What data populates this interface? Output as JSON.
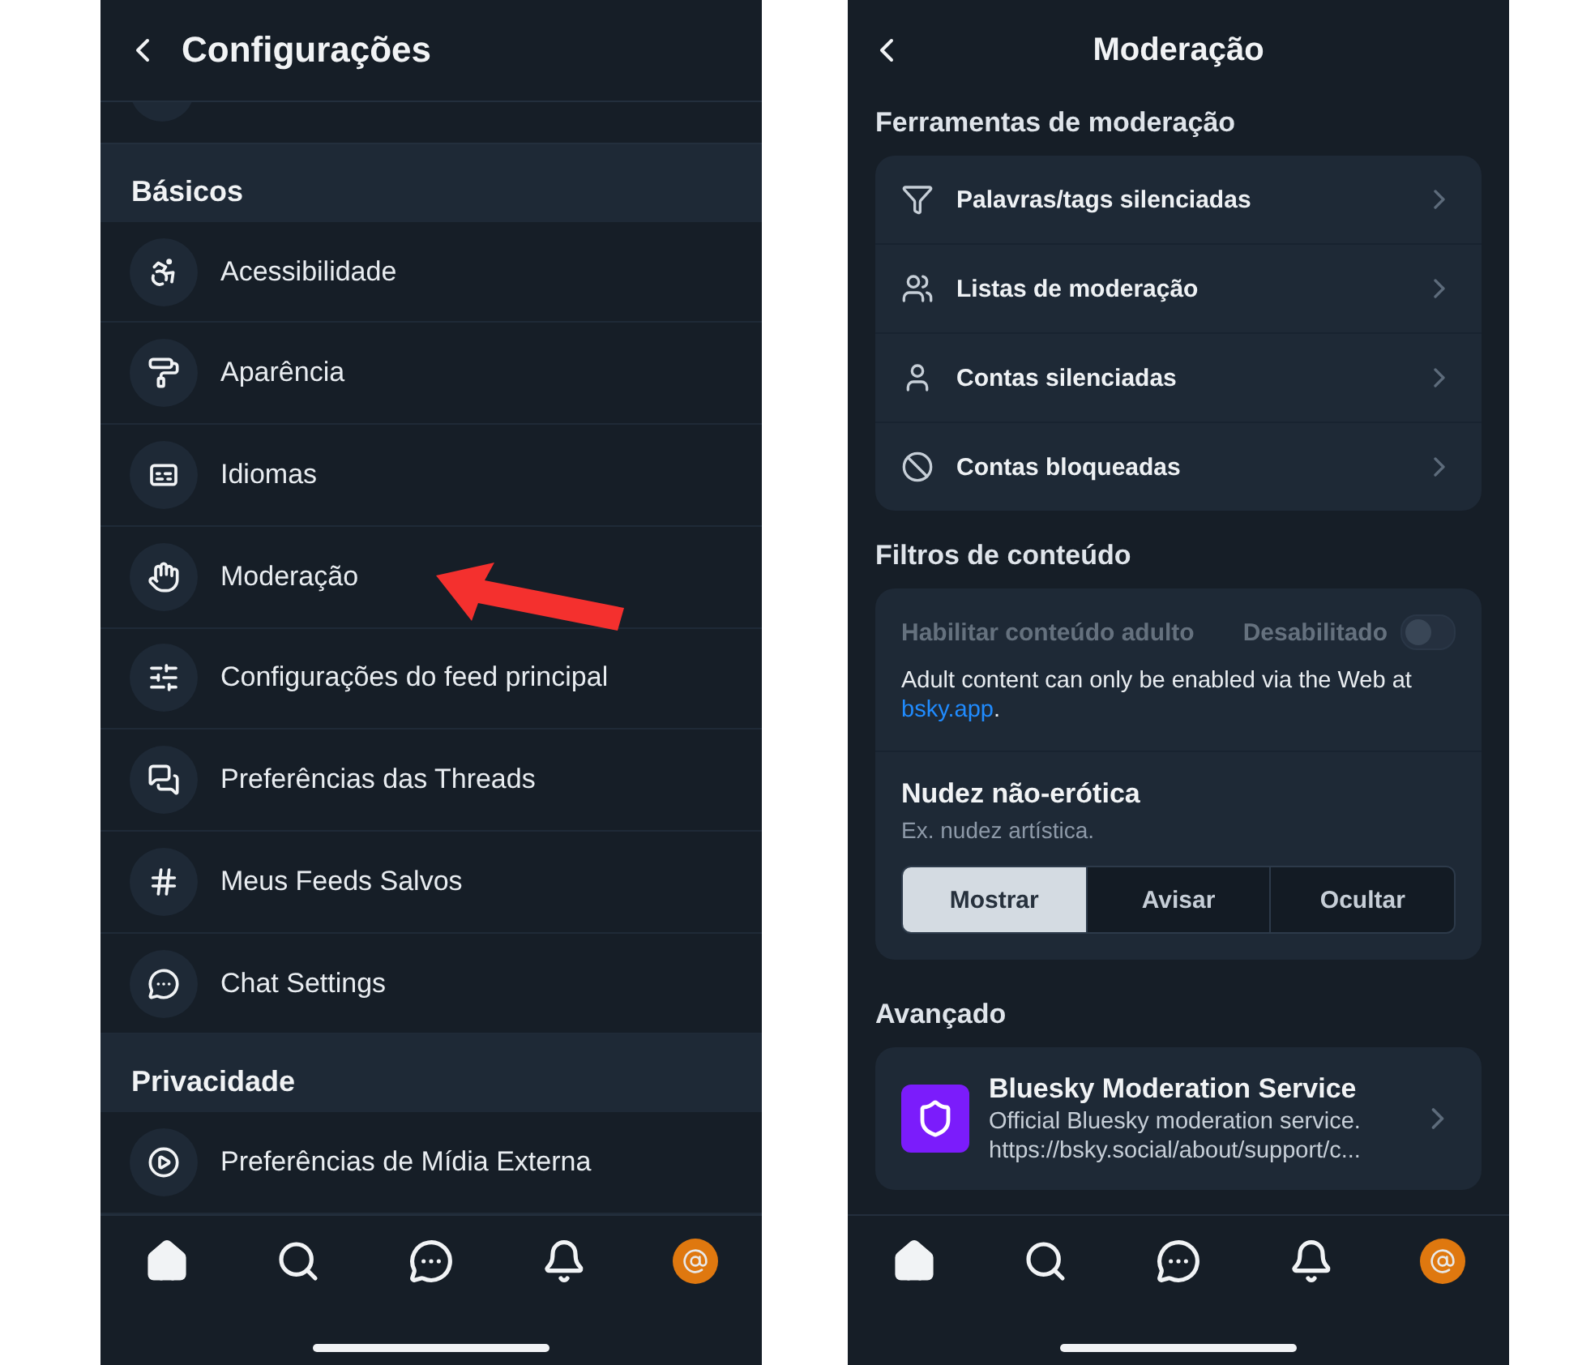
{
  "settings_screen": {
    "title": "Configurações",
    "sections": [
      {
        "title": "Básicos",
        "items": [
          {
            "label": "Acessibilidade",
            "highlighted": false
          },
          {
            "label": "Aparência",
            "highlighted": false
          },
          {
            "label": "Idiomas",
            "highlighted": false
          },
          {
            "label": "Moderação",
            "highlighted": true
          },
          {
            "label": "Configurações do feed principal",
            "highlighted": false
          },
          {
            "label": "Preferências das Threads",
            "highlighted": false
          },
          {
            "label": "Meus Feeds Salvos",
            "highlighted": false
          },
          {
            "label": "Chat Settings",
            "highlighted": false
          }
        ]
      },
      {
        "title": "Privacidade",
        "items": [
          {
            "label": "Preferências de Mídia Externa",
            "highlighted": false
          }
        ]
      }
    ],
    "nav_items": [
      {
        "selected": true
      },
      {
        "selected": false
      },
      {
        "selected": false
      },
      {
        "selected": false
      },
      {
        "selected": false
      }
    ]
  },
  "moderation_screen": {
    "title": "Moderação",
    "tools_title": "Ferramentas de moderação",
    "tools": [
      {
        "label": "Palavras/tags silenciadas"
      },
      {
        "label": "Listas de moderação"
      },
      {
        "label": "Contas silenciadas"
      },
      {
        "label": "Contas bloqueadas"
      }
    ],
    "filters_title": "Filtros de conteúdo",
    "adult_content": {
      "label": "Habilitar conteúdo adulto",
      "status": "Desabilitado",
      "on": false,
      "disabled": true
    },
    "note_text": "Adult content can only be enabled via the Web at",
    "note_link": "bsky.app",
    "note_suffix": ".",
    "filter": {
      "title": "Nudez não-erótica",
      "description": "Ex. nudez artística.",
      "options": [
        {
          "label": "Mostrar",
          "selected": true
        },
        {
          "label": "Avisar",
          "selected": false
        },
        {
          "label": "Ocultar",
          "selected": false
        }
      ]
    },
    "advanced_title": "Avançado",
    "labeler": {
      "name": "Bluesky Moderation Service",
      "description": "Official Bluesky moderation service.",
      "url": "https://bsky.social/about/support/c..."
    },
    "nav_items": [
      {
        "selected": true
      },
      {
        "selected": false
      },
      {
        "selected": false
      },
      {
        "selected": false
      },
      {
        "selected": false
      }
    ]
  }
}
